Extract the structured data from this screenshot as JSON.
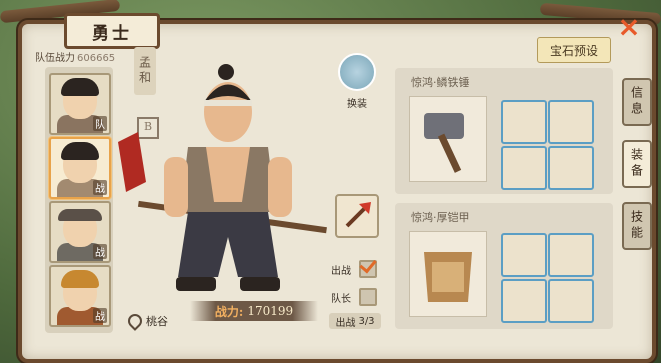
{
  "header": {
    "title": "勇士",
    "close_label": "×"
  },
  "squad": {
    "label": "队伍战力",
    "value": "606665"
  },
  "roster": [
    {
      "tag": "队",
      "hair": "#2b2420",
      "body": "#8a7460",
      "selected": false
    },
    {
      "tag": "战",
      "hair": "#2b2420",
      "body": "#a28a70",
      "selected": true
    },
    {
      "tag": "战",
      "hair": "#5a5048",
      "body": "#6e6a62",
      "selected": false
    },
    {
      "tag": "战",
      "hair": "#c78830",
      "body": "#a05a30",
      "selected": false
    }
  ],
  "hero": {
    "name": "孟和",
    "seal": "B"
  },
  "switch_label": "换装",
  "checks": {
    "sortie_label": "出战",
    "sortie_on": true,
    "captain_label": "队长",
    "captain_on": false
  },
  "sortie_count": {
    "label": "出战",
    "value": "3/3"
  },
  "power": {
    "label": "战力:",
    "value": "170199"
  },
  "location": "桃谷",
  "preset_label": "宝石预设",
  "weapon_panel": {
    "title": "惊鸿·鳞铁锤"
  },
  "armor_panel": {
    "title": "惊鸿·厚铠甲"
  },
  "tabs": [
    {
      "label": "信息",
      "active": false
    },
    {
      "label": "装备",
      "active": true
    },
    {
      "label": "技能",
      "active": false
    }
  ],
  "colors": {
    "accent": "#e8a34a",
    "frame": "#6b4a2e",
    "slot_border": "#5b9ec4"
  }
}
